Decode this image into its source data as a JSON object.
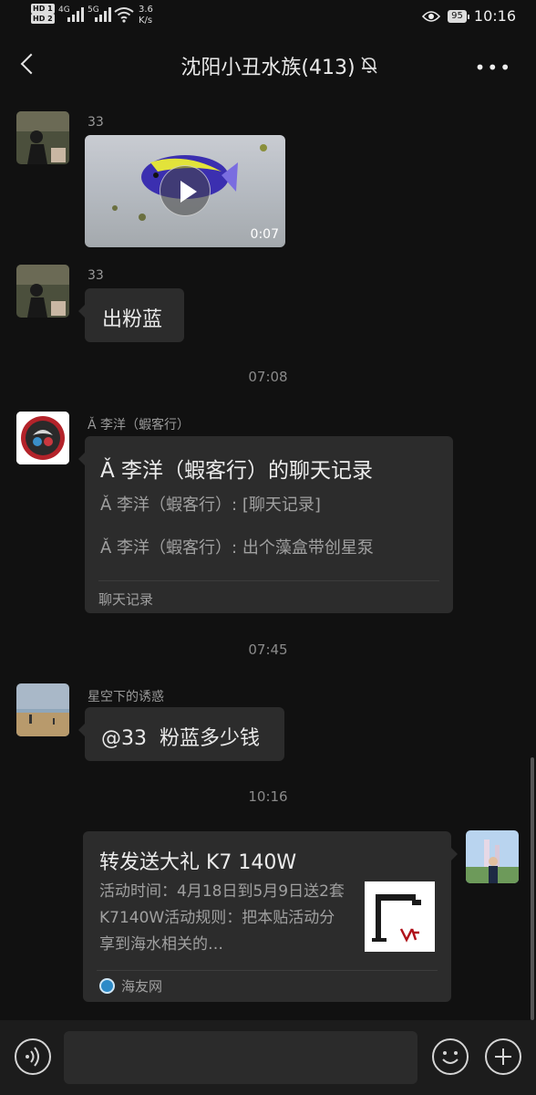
{
  "status_bar": {
    "sim1": "HD 1",
    "sim2": "HD 2",
    "net1": "4G",
    "net2": "5G",
    "speed_value": "3.6",
    "speed_unit": "K/s",
    "battery": "95",
    "time": "10:16",
    "icons": [
      "eye-icon",
      "wifi-icon",
      "battery-icon"
    ]
  },
  "header": {
    "title": "沈阳小丑水族(413)",
    "icons": [
      "back-arrow-icon",
      "mute-bell-icon",
      "more-icon"
    ]
  },
  "messages": [
    {
      "type": "video",
      "sender": "33",
      "duration": "0:07"
    },
    {
      "type": "text",
      "sender": "33",
      "text": "出粉蓝"
    },
    {
      "type": "time",
      "text": "07:08"
    },
    {
      "type": "chat_record",
      "sender": "Ǎ 李洋（蝦客行）",
      "title": "Ǎ 李洋（蝦客行）的聊天记录",
      "lines": [
        "Ǎ 李洋（蝦客行）: [聊天记录]",
        "Ǎ 李洋（蝦客行）: 出个藻盒带创星泵"
      ],
      "footer": "聊天记录"
    },
    {
      "type": "time",
      "text": "07:45"
    },
    {
      "type": "text",
      "sender": "星空下的诱惑",
      "text": "@33  粉蓝多少钱"
    },
    {
      "type": "time",
      "text": "10:16"
    },
    {
      "type": "link",
      "side": "right",
      "title": "转发送大礼 K7 140W",
      "description": "活动时间：4月18日到5月9日送2套K7140W活动规则：把本贴活动分享到海水相关的…",
      "source": "海友网"
    }
  ],
  "input_bar": {
    "text": "",
    "icons": [
      "voice-icon",
      "emoji-icon",
      "plus-icon"
    ]
  },
  "colors": {
    "background": "#111111",
    "bubble": "#2c2c2c",
    "secondary_text": "#9a9a9a"
  }
}
